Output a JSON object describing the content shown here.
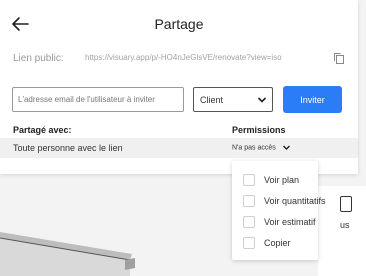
{
  "dialog": {
    "title": "Partage",
    "link_label": "Lien public:",
    "link_url": "https://visuary.app/p/-HO4nJeGlsVE/renovate?view=iso"
  },
  "invite": {
    "email_placeholder": "L'adresse email de l'utilisateur à inviter",
    "role_value": "Client",
    "button_label": "Inviter"
  },
  "shared": {
    "col_shared": "Partagé avec:",
    "col_permissions": "Permissions",
    "rows": [
      {
        "name": "Toute personne avec le lien",
        "permission": "N'a pas accès"
      }
    ]
  },
  "permissions_menu": {
    "items": [
      {
        "label": "Voir plan",
        "checked": false
      },
      {
        "label": "Voir quantitatifs",
        "checked": false
      },
      {
        "label": "Voir estimatif",
        "checked": false
      },
      {
        "label": "Copier",
        "checked": false
      }
    ]
  },
  "background": {
    "partial_label": "us"
  },
  "colors": {
    "accent": "#2b7cf7"
  }
}
